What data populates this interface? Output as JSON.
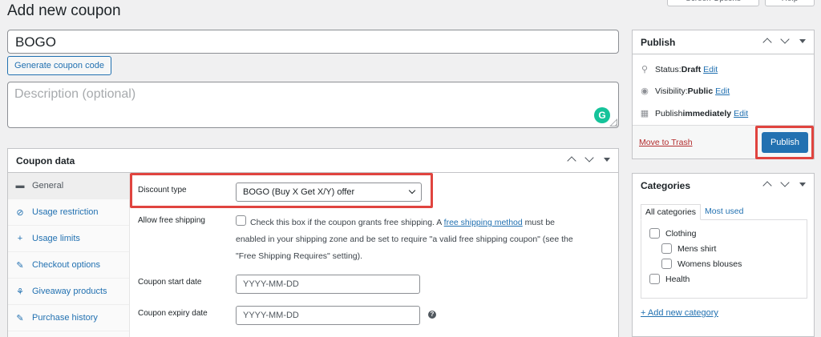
{
  "top_buttons": {
    "screen_options": "Screen Options",
    "help": "Help"
  },
  "page_title": "Add new coupon",
  "coupon_code": "BOGO",
  "generate_button": "Generate coupon code",
  "description_placeholder": "Description (optional)",
  "grammarly_icon": "G",
  "coupon_data": {
    "title": "Coupon data",
    "tabs": [
      {
        "label": "General",
        "icon": "ticket-icon",
        "glyph": "▬"
      },
      {
        "label": "Usage restriction",
        "icon": "block-icon",
        "glyph": "⊘"
      },
      {
        "label": "Usage limits",
        "icon": "plus-icon",
        "glyph": "+"
      },
      {
        "label": "Checkout options",
        "icon": "wrench-icon",
        "glyph": "✎"
      },
      {
        "label": "Giveaway products",
        "icon": "gift-icon",
        "glyph": "⚘"
      },
      {
        "label": "Purchase history",
        "icon": "wrench-icon",
        "glyph": "✎"
      }
    ],
    "discount_type_label": "Discount type",
    "discount_type_value": "BOGO (Buy X Get X/Y) offer",
    "free_shipping_label": "Allow free shipping",
    "free_shipping_text_1": "Check this box if the coupon grants free shipping. A ",
    "free_shipping_link": "free shipping method",
    "free_shipping_text_2": " must be",
    "free_shipping_text_3": "enabled in your shipping zone and be set to require \"a valid free shipping coupon\" (see the",
    "free_shipping_text_4": "\"Free Shipping Requires\" setting).",
    "start_date_label": "Coupon start date",
    "start_date_placeholder": "YYYY-MM-DD",
    "expiry_date_label": "Coupon expiry date",
    "expiry_date_placeholder": "YYYY-MM-DD",
    "help_glyph": "?"
  },
  "publish": {
    "title": "Publish",
    "status_label": "Status: ",
    "status_value": "Draft",
    "visibility_label": "Visibility: ",
    "visibility_value": "Public",
    "publish_label": "Publish ",
    "publish_value": "immediately",
    "edit": "Edit",
    "trash": "Move to Trash",
    "button": "Publish"
  },
  "categories": {
    "title": "Categories",
    "tabs": [
      "All categories",
      "Most used"
    ],
    "items": [
      {
        "label": "Clothing",
        "level": 0
      },
      {
        "label": "Mens shirt",
        "level": 1
      },
      {
        "label": "Womens blouses",
        "level": 1
      },
      {
        "label": "Health",
        "level": 0
      }
    ],
    "add_new": "+ Add new category"
  },
  "colors": {
    "accent": "#2271b1",
    "highlight": "#e0443f",
    "trash": "#b32d2e"
  }
}
